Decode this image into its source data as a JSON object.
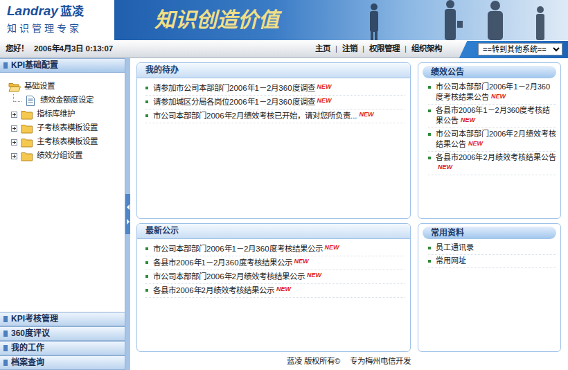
{
  "header": {
    "logo": {
      "brand": "Landray",
      "cn": "蓝凌",
      "tagline": "知识管理专家"
    },
    "slogan": "知识创造价值"
  },
  "top_bar": {
    "greeting": "您好！",
    "datetime": "2006年4月3日 0:13:07",
    "nav": [
      "主页",
      "注销",
      "权限管理",
      "组织架构"
    ],
    "separator": "|",
    "system_select": "==转到其他系统=="
  },
  "sidebar": {
    "sections": [
      {
        "label": "KPI基础配置",
        "selected": true,
        "tree": [
          {
            "label": "基础设置",
            "kind": "folder-open"
          },
          {
            "label": "绩效金额度设定",
            "kind": "doc"
          },
          {
            "label": "指标库维护",
            "kind": "folder"
          },
          {
            "label": "子考核表模板设置",
            "kind": "folder"
          },
          {
            "label": "主考核表模板设置",
            "kind": "folder"
          },
          {
            "label": "绩效分组设置",
            "kind": "folder"
          }
        ]
      },
      {
        "label": "KPI考核管理",
        "selected": false,
        "tree": []
      },
      {
        "label": "360度评议",
        "selected": false,
        "tree": []
      },
      {
        "label": "我的工作",
        "selected": false,
        "tree": []
      },
      {
        "label": "档案查询",
        "selected": false,
        "tree": []
      }
    ]
  },
  "panels": {
    "todo": {
      "title": "我的待办",
      "items": [
        {
          "text": "请参加市公司本部部门2006年1－2月360度调查",
          "badge": "NEW"
        },
        {
          "text": "请参加城区分局各岗位2006年1－2月360度调查",
          "badge": "NEW"
        },
        {
          "text": "市公司本部部门2006年2月绩效考核已开始，请对您所负责...",
          "badge": "NEW"
        }
      ]
    },
    "notices": {
      "title": "最新公示",
      "items": [
        {
          "text": "市公司本部部门2006年1－2月360度考核结果公示",
          "badge": "NEW"
        },
        {
          "text": "各县市2006年1－2月360度考核结果公示",
          "badge": "NEW"
        },
        {
          "text": "市公司本部部门2006年2月绩效考核结果公示",
          "badge": "NEW"
        },
        {
          "text": "各县市2006年2月绩效考核结果公示",
          "badge": "NEW"
        }
      ]
    },
    "announcements": {
      "title": "绩效公告",
      "items": [
        {
          "text": "市公司本部部门2006年1－2月360度考核结果公告",
          "badge": "NEW"
        },
        {
          "text": "各县市2006年1－2月360度考核结果公告",
          "badge": "NEW"
        },
        {
          "text": "市公司本部部门2006年2月绩效考核结果公告",
          "badge": "NEW"
        },
        {
          "text": "各县市2006年2月绩效考核结果公告",
          "badge": "NEW"
        }
      ]
    },
    "resources": {
      "title": "常用资料",
      "items": [
        {
          "text": "员工通讯录",
          "badge": ""
        },
        {
          "text": "常用网址",
          "badge": ""
        }
      ]
    }
  },
  "footer": {
    "copyright": "蓝凌 版权所有©",
    "dev": "专为梅州电信开发"
  }
}
